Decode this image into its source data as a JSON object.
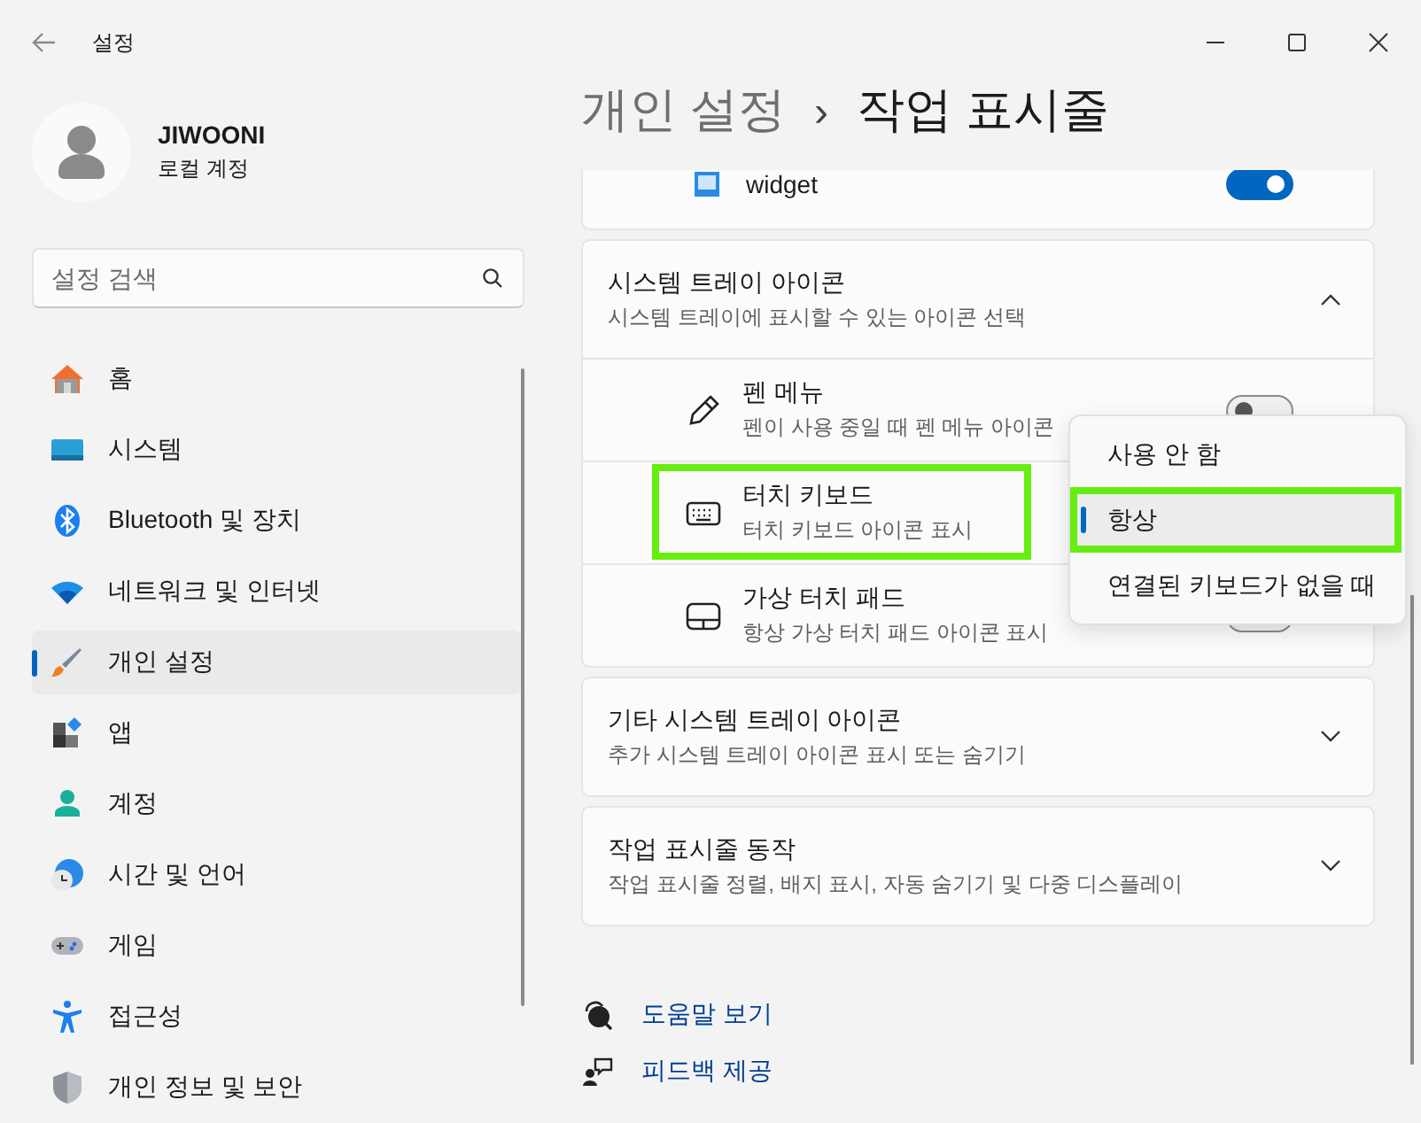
{
  "window": {
    "title": "설정"
  },
  "profile": {
    "name": "JIWOONI",
    "account": "로컬 계정"
  },
  "search": {
    "placeholder": "설정 검색"
  },
  "nav": [
    {
      "label": "홈",
      "selected": false
    },
    {
      "label": "시스템",
      "selected": false
    },
    {
      "label": "Bluetooth 및 장치",
      "selected": false
    },
    {
      "label": "네트워크 및 인터넷",
      "selected": false
    },
    {
      "label": "개인 설정",
      "selected": true
    },
    {
      "label": "앱",
      "selected": false
    },
    {
      "label": "계정",
      "selected": false
    },
    {
      "label": "시간 및 언어",
      "selected": false
    },
    {
      "label": "게임",
      "selected": false
    },
    {
      "label": "접근성",
      "selected": false
    },
    {
      "label": "개인 정보 및 보안",
      "selected": false
    }
  ],
  "breadcrumb": {
    "parent": "개인 설정",
    "separator": "›",
    "current": "작업 표시줄"
  },
  "widget_row": {
    "label": "widget",
    "on": true
  },
  "tray": {
    "title": "시스템 트레이 아이콘",
    "subtitle": "시스템 트레이에 표시할 수 있는 아이콘 선택",
    "expanded": true,
    "rows": [
      {
        "kind": "pen",
        "title": "펜 메뉴",
        "subtitle": "펜이 사용 중일 때 펜 메뉴 아이콘",
        "on": false,
        "highlighted": false
      },
      {
        "kind": "keyboard",
        "title": "터치 키보드",
        "subtitle": "터치 키보드 아이콘 표시",
        "highlighted": true
      },
      {
        "kind": "touchpad",
        "title": "가상 터치 패드",
        "subtitle": "항상 가상 터치 패드 아이콘 표시",
        "on": false,
        "highlighted": false
      }
    ]
  },
  "sections": [
    {
      "title": "기타 시스템 트레이 아이콘",
      "subtitle": "추가 시스템 트레이 아이콘 표시 또는 숨기기",
      "expanded": false
    },
    {
      "title": "작업 표시줄 동작",
      "subtitle": "작업 표시줄 정렬, 배지 표시, 자동 숨기기 및 다중 디스플레이",
      "expanded": false
    }
  ],
  "dropdown": {
    "options": [
      {
        "label": "사용 안 함",
        "selected": false,
        "highlighted": false
      },
      {
        "label": "항상",
        "selected": true,
        "highlighted": true
      },
      {
        "label": "연결된 키보드가 없을 때",
        "selected": false,
        "highlighted": false
      }
    ]
  },
  "links": [
    {
      "label": "도움말 보기"
    },
    {
      "label": "피드백 제공"
    }
  ]
}
